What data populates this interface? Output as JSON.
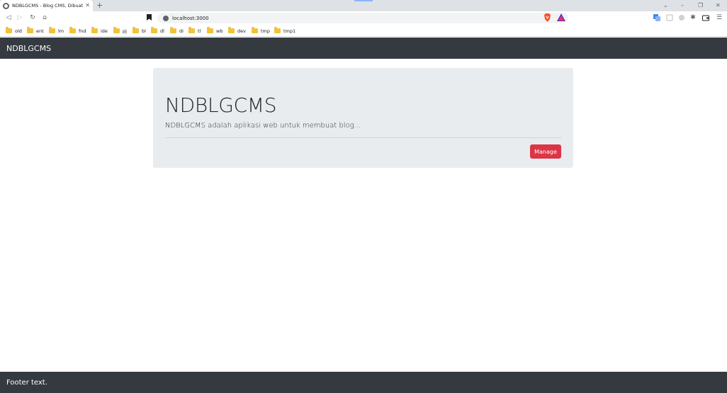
{
  "browser": {
    "tab_title": "NDBLGCMS - Blog CMS, Dibuat l",
    "url": "localhost:3000",
    "bookmarks": [
      "old",
      "ent",
      "lm",
      "fnd",
      "ide",
      "pj",
      "bl",
      "dl",
      "di",
      "tl",
      "wb",
      "dev",
      "tmp",
      "tmp1"
    ]
  },
  "navbar": {
    "brand": "NDBLGCMS"
  },
  "jumbotron": {
    "title": "NDBLGCMS",
    "lead": "NDBLGCMS adalah aplikasi web untuk membuat blog...",
    "button_label": "Manage"
  },
  "footer": {
    "text": "Footer text."
  },
  "colors": {
    "navbar_bg": "#343a40",
    "jumbotron_bg": "#e9ecef",
    "danger": "#dc3545"
  }
}
